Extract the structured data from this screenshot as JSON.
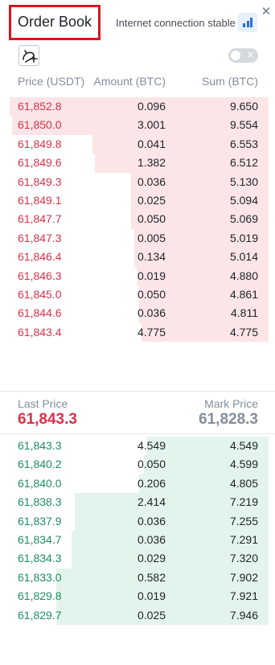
{
  "header": {
    "title": "Order Book",
    "connection_status": "Internet connection stable",
    "signal_icon": "signal-bars-icon",
    "close_icon": "close-icon"
  },
  "toolbar": {
    "depth_icon": "depth-chart-icon",
    "toggle_state": "off"
  },
  "columns": {
    "price": "Price (USDT)",
    "amount": "Amount (BTC)",
    "sum": "Sum (BTC)"
  },
  "asks": [
    {
      "price": "61,852.8",
      "amount": "0.096",
      "sum": "9.650",
      "depth": 1.0
    },
    {
      "price": "61,850.0",
      "amount": "3.001",
      "sum": "9.554",
      "depth": 0.99
    },
    {
      "price": "61,849.8",
      "amount": "0.041",
      "sum": "6.553",
      "depth": 0.68
    },
    {
      "price": "61,849.6",
      "amount": "1.382",
      "sum": "6.512",
      "depth": 0.67
    },
    {
      "price": "61,849.3",
      "amount": "0.036",
      "sum": "5.130",
      "depth": 0.53
    },
    {
      "price": "61,849.1",
      "amount": "0.025",
      "sum": "5.094",
      "depth": 0.53
    },
    {
      "price": "61,847.7",
      "amount": "0.050",
      "sum": "5.069",
      "depth": 0.53
    },
    {
      "price": "61,847.3",
      "amount": "0.005",
      "sum": "5.019",
      "depth": 0.52
    },
    {
      "price": "61,846.4",
      "amount": "0.134",
      "sum": "5.014",
      "depth": 0.52
    },
    {
      "price": "61,846.3",
      "amount": "0.019",
      "sum": "4.880",
      "depth": 0.51
    },
    {
      "price": "61,845.0",
      "amount": "0.050",
      "sum": "4.861",
      "depth": 0.5
    },
    {
      "price": "61,844.6",
      "amount": "0.036",
      "sum": "4.811",
      "depth": 0.5
    },
    {
      "price": "61,843.4",
      "amount": "4.775",
      "sum": "4.775",
      "depth": 0.49
    }
  ],
  "last_price": {
    "label": "Last Price",
    "value": "61,843.3"
  },
  "mark_price": {
    "label": "Mark Price",
    "value": "61,828.3"
  },
  "bids": [
    {
      "price": "61,843.3",
      "amount": "4.549",
      "sum": "4.549",
      "depth": 0.47
    },
    {
      "price": "61,840.2",
      "amount": "0.050",
      "sum": "4.599",
      "depth": 0.48
    },
    {
      "price": "61,840.0",
      "amount": "0.206",
      "sum": "4.805",
      "depth": 0.5
    },
    {
      "price": "61,838.3",
      "amount": "2.414",
      "sum": "7.219",
      "depth": 0.75
    },
    {
      "price": "61,837.9",
      "amount": "0.036",
      "sum": "7.255",
      "depth": 0.75
    },
    {
      "price": "61,834.7",
      "amount": "0.036",
      "sum": "7.291",
      "depth": 0.76
    },
    {
      "price": "61,834.3",
      "amount": "0.029",
      "sum": "7.320",
      "depth": 0.76
    },
    {
      "price": "61,833.0",
      "amount": "0.582",
      "sum": "7.902",
      "depth": 0.82
    },
    {
      "price": "61,829.8",
      "amount": "0.019",
      "sum": "7.921",
      "depth": 0.82
    },
    {
      "price": "61,829.7",
      "amount": "0.025",
      "sum": "7.946",
      "depth": 0.82
    }
  ],
  "colors": {
    "ask": "#d9324a",
    "bid": "#1e8e5e",
    "ask_bg": "#fbe5e7",
    "bid_bg": "#e3f4ec",
    "highlight_border": "#d9151c"
  }
}
